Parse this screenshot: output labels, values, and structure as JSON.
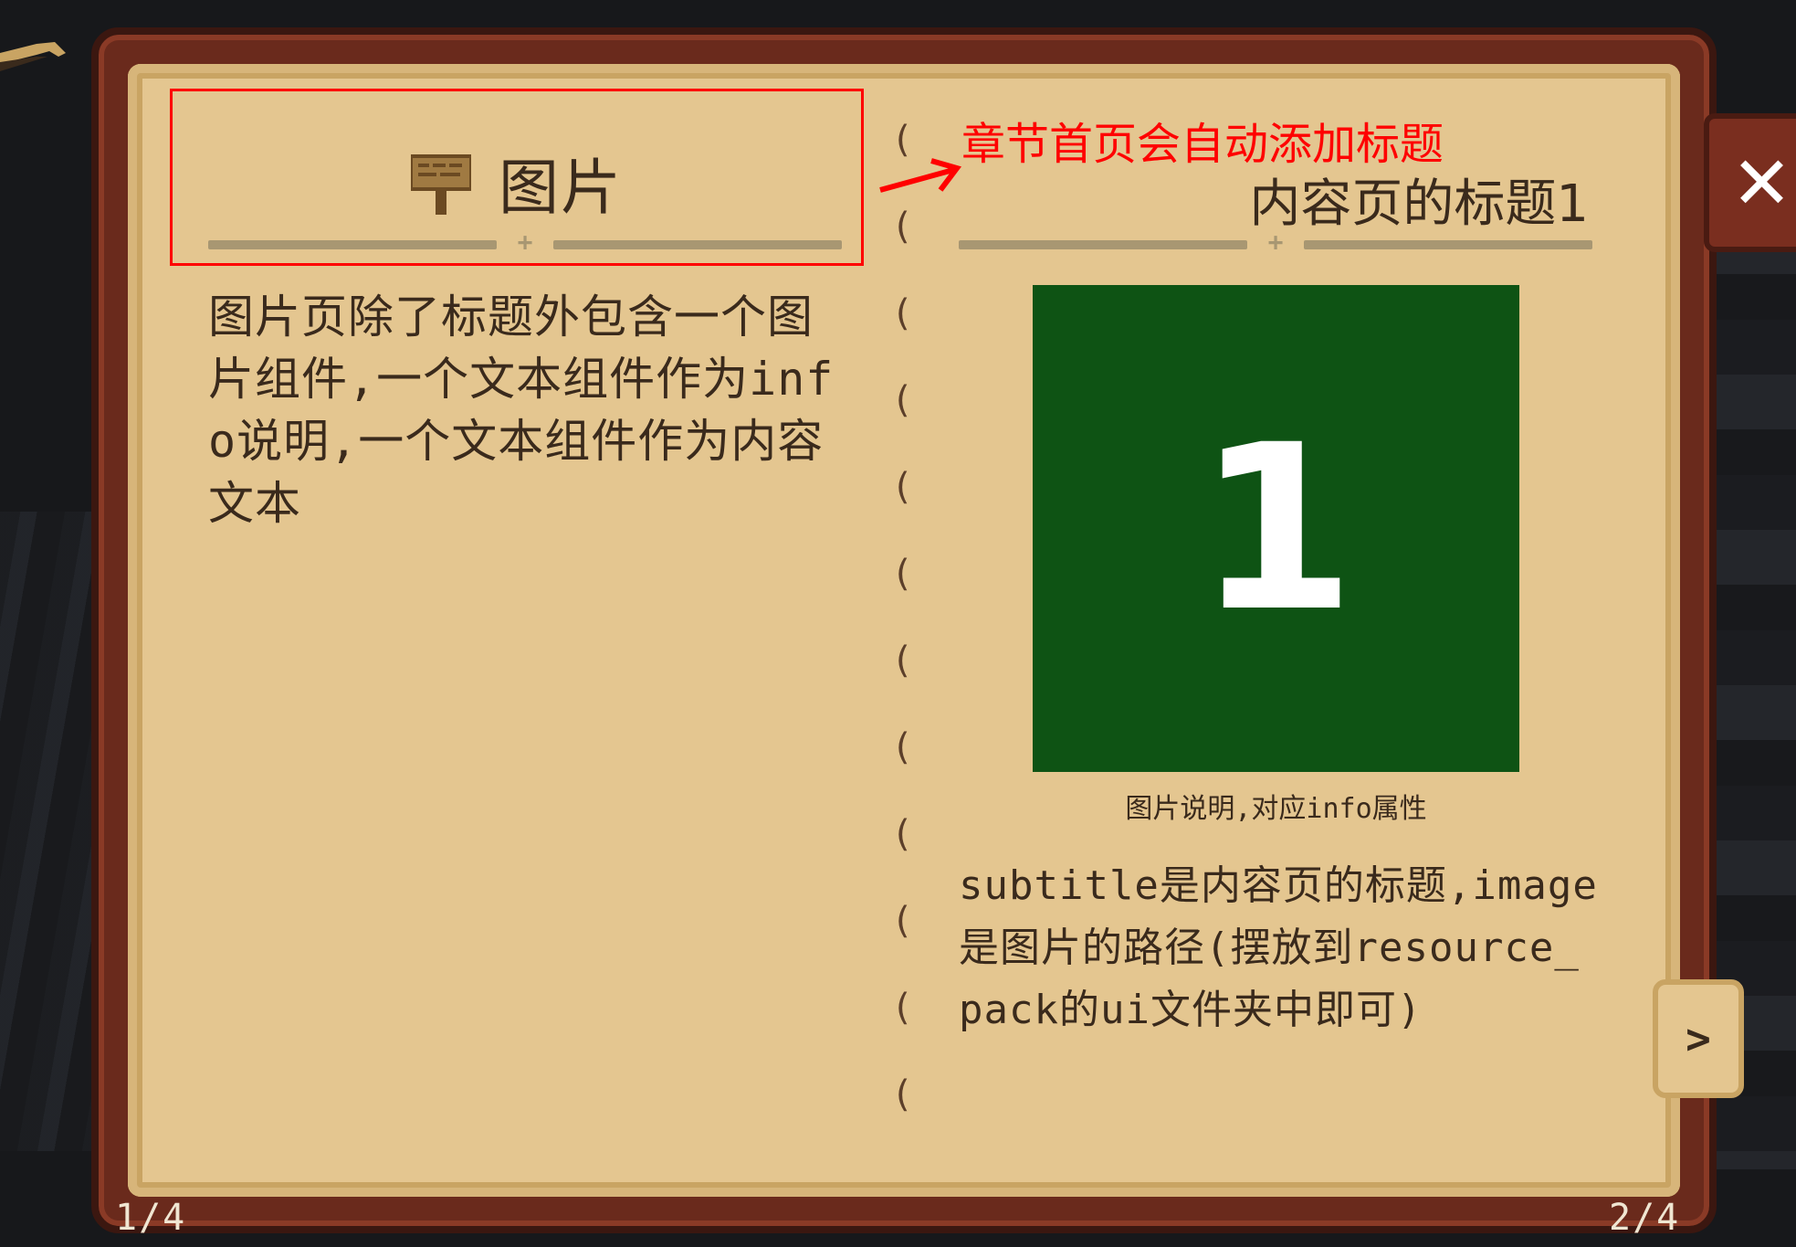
{
  "left_page": {
    "chapter_title": "图片",
    "body": "图片页除了标题外包含一个图片组件,一个文本组件作为info说明,一个文本组件作为内容文本",
    "page_number": "1/4"
  },
  "annotation": {
    "text": "章节首页会自动添加标题",
    "color": "#ff0000"
  },
  "right_page": {
    "subtitle": "内容页的标题1",
    "image_label": "1",
    "image_color": "#0e5314",
    "info": "图片说明,对应info属性",
    "body": "subtitle是内容页的标题,image是图片的路径(摆放到resource_pack的ui文件夹中即可)",
    "page_number": "2/4"
  },
  "controls": {
    "close_label": "✕",
    "next_label": ">"
  },
  "icons": {
    "title_icon": "wooden-sign-icon",
    "close": "close-icon",
    "next": "chevron-right-icon"
  }
}
